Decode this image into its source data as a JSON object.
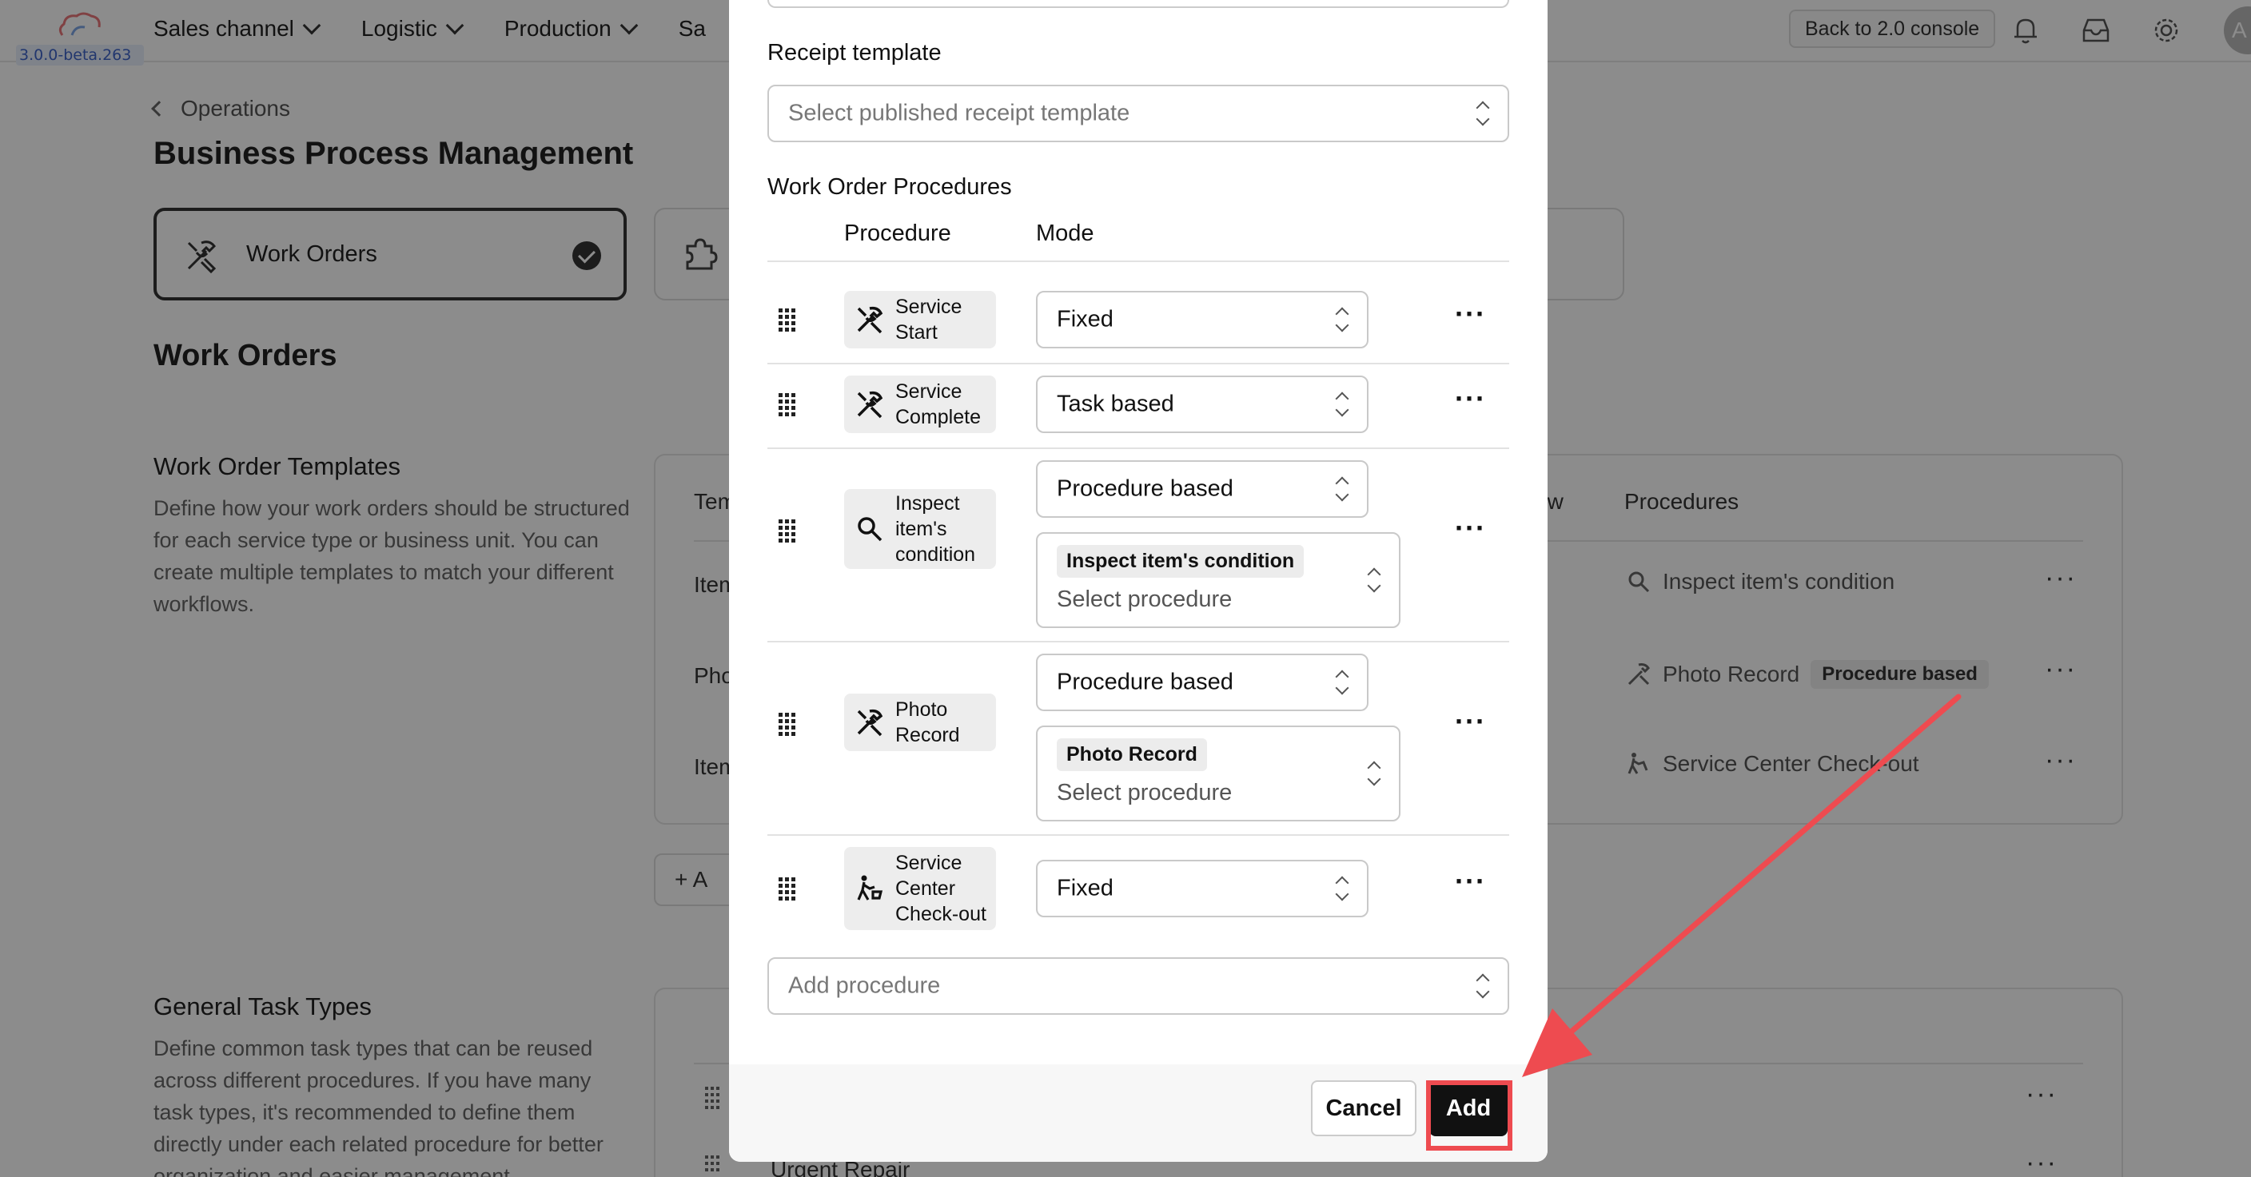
{
  "app": {
    "version": "3.0.0-beta.263",
    "nav": [
      "Sales channel",
      "Logistic",
      "Production",
      "Sa"
    ],
    "back_label": "Back to 2.0 console",
    "avatar_letter": "A"
  },
  "page": {
    "breadcrumb": "Operations",
    "title": "Business Process Management",
    "active_card": "Work Orders",
    "section_title": "Work Orders",
    "templates": {
      "title": "Work Order Templates",
      "description": "Define how your work orders should be structured for each service type or business unit. You can create multiple templates to match your different workflows.",
      "col_template": "Tem",
      "col_flow": "ow",
      "col_procedures": "Procedures",
      "rows": [
        {
          "name": "Item",
          "procedure": "Inspect item's condition",
          "badge": ""
        },
        {
          "name": "Pho",
          "procedure": "Photo Record",
          "badge": "Procedure based"
        },
        {
          "name": "Item",
          "procedure": "Service Center Check-out",
          "badge": ""
        }
      ],
      "add_label": "+ A"
    },
    "tasks": {
      "title": "General Task Types",
      "description": "Define common task types that can be reused across different procedures. If you have many task types, it's recommended to define them directly under each related procedure for better organization and easier management.",
      "rows": [
        "",
        "Urgent Repair"
      ]
    }
  },
  "modal": {
    "receipt_label": "Receipt template",
    "receipt_placeholder": "Select published receipt template",
    "procedures_label": "Work Order Procedures",
    "col_procedure": "Procedure",
    "col_mode": "Mode",
    "procedures": [
      {
        "name": "Service Start",
        "mode": "Fixed",
        "icon": "tools-icon"
      },
      {
        "name": "Service Complete",
        "mode": "Task based",
        "icon": "tools-icon"
      },
      {
        "name": "Inspect item's condition",
        "mode": "Procedure based",
        "tag": "Inspect item's condition",
        "placeholder": "Select procedure",
        "icon": "search-icon"
      },
      {
        "name": "Photo Record",
        "mode": "Procedure based",
        "tag": "Photo Record",
        "placeholder": "Select procedure",
        "icon": "tools-icon"
      },
      {
        "name": "Service Center Check-out",
        "mode": "Fixed",
        "icon": "walker-cart-icon"
      }
    ],
    "add_procedure_placeholder": "Add procedure",
    "cancel_label": "Cancel",
    "add_label": "Add"
  },
  "colors": {
    "highlight": "#ee4b50",
    "primary_button": "#111111",
    "overlay": "rgba(0,0,0,0.45)"
  }
}
